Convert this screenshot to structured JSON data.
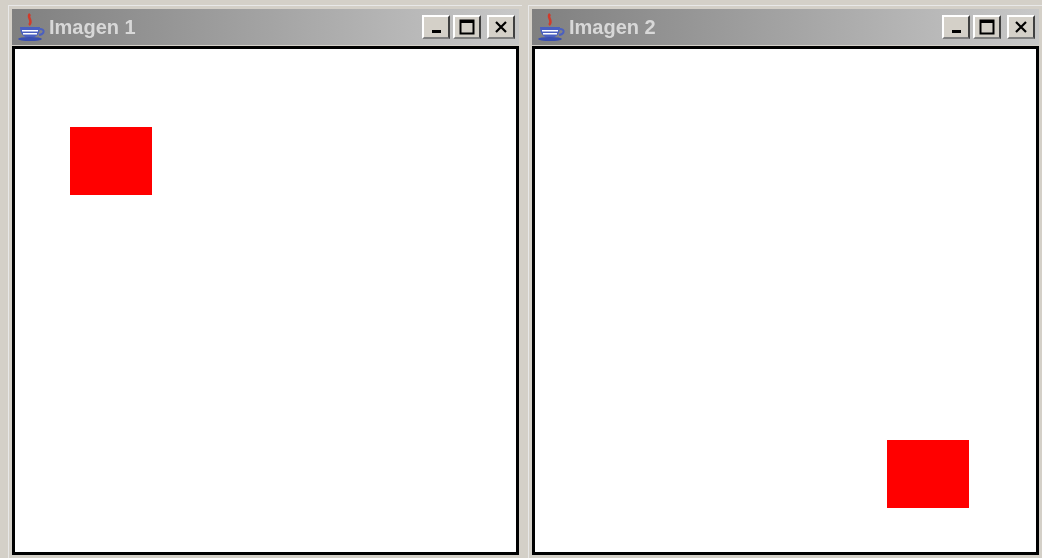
{
  "windows": [
    {
      "title": "Imagen 1",
      "active": false,
      "shape": {
        "kind": "rectangle",
        "color": "#ff0000"
      }
    },
    {
      "title": "Imagen 2",
      "active": false,
      "shape": {
        "kind": "rectangle",
        "color": "#ff0000"
      }
    }
  ]
}
